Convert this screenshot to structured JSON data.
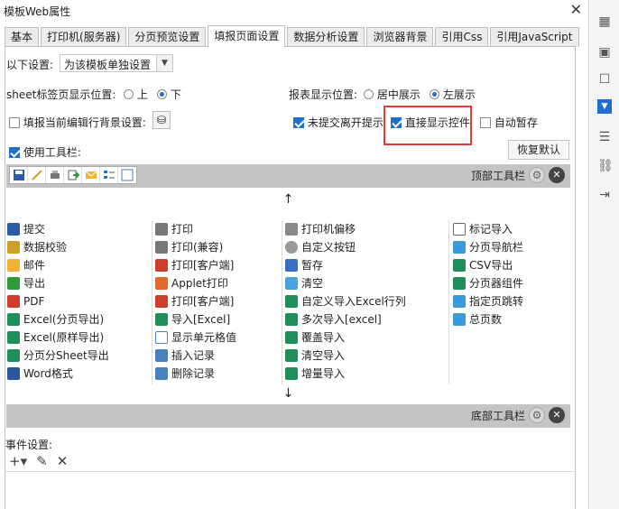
{
  "window": {
    "title": "模板Web属性",
    "close": "✕"
  },
  "tabs": [
    "基本",
    "打印机(服务器)",
    "分页预览设置",
    "填报页面设置",
    "数据分析设置",
    "浏览器背景",
    "引用Css",
    "引用JavaScript"
  ],
  "active_tab": "填报页面设置",
  "settings": {
    "apply_label": "以下设置:",
    "apply_select": "为该模板单独设置",
    "sheet_pos_label": "sheet标签页显示位置:",
    "sheet_pos_options": [
      "上",
      "下"
    ],
    "sheet_pos_selected": "下",
    "report_pos_label": "报表显示位置:",
    "report_pos_options": [
      "居中展示",
      "左展示"
    ],
    "report_pos_selected": "左展示",
    "row_bg_label": "填报当前编辑行背景设置:",
    "unsubmitted_leave_label": "未提交离开提示",
    "direct_show_label": "直接显示控件",
    "auto_save_label": "自动暂存",
    "use_toolbar_label": "使用工具栏:",
    "restore_default": "恢复默认"
  },
  "top_toolbar_label": "顶部工具栏",
  "bottom_toolbar_label": "底部工具栏",
  "arrow_up": "↑",
  "arrow_down": "↓",
  "columns": [
    [
      "提交",
      "数据校验",
      "邮件",
      "导出",
      "PDF",
      "Excel(分页导出)",
      "Excel(原样导出)",
      "分页分Sheet导出",
      "Word格式"
    ],
    [
      "打印",
      "打印(兼容)",
      "打印[客户端]",
      "Applet打印",
      "打印[客户端]",
      "导入[Excel]",
      "显示单元格值",
      "插入记录",
      "删除记录"
    ],
    [
      "打印机偏移",
      "自定义按钮",
      "暂存",
      "清空",
      "自定义导入Excel行列",
      "多次导入[excel]",
      "覆盖导入",
      "清空导入",
      "增量导入"
    ],
    [
      "标记导入",
      "分页导航栏",
      "CSV导出",
      "分页器组件",
      "指定页跳转",
      "总页数"
    ]
  ],
  "events_label": "事件设置:",
  "colors": {
    "accent": "#1e6fd0",
    "highlight_box": "#e23b3b",
    "toolbar_band": "#c4c4c4"
  }
}
